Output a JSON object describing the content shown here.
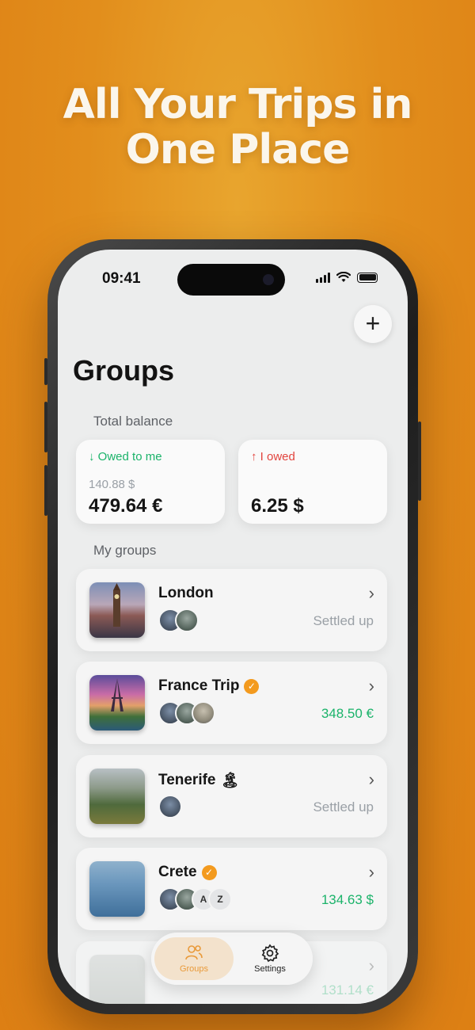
{
  "headline": {
    "line1": "All Your Trips in",
    "line2": "One Place"
  },
  "status_bar": {
    "time": "09:41"
  },
  "header": {
    "add_label": "+",
    "title": "Groups"
  },
  "balance": {
    "section_label": "Total balance",
    "owed_to_me": {
      "arrow": "↓",
      "label": "Owed to me",
      "secondary": "140.88 $",
      "primary": "479.64 €"
    },
    "i_owed": {
      "arrow": "↑",
      "label": "I owed",
      "primary": "6.25 $"
    }
  },
  "groups_section_label": "My groups",
  "groups": [
    {
      "name": "London",
      "badge": "",
      "emoji": "",
      "avatars": [
        "person",
        "person"
      ],
      "status": "Settled up",
      "status_type": "settled",
      "chevron": "›"
    },
    {
      "name": "France Trip",
      "badge": "✓",
      "emoji": "",
      "avatars": [
        "person",
        "person",
        "person"
      ],
      "status": "348.50 €",
      "status_type": "positive",
      "chevron": "›"
    },
    {
      "name": "Tenerife",
      "badge": "",
      "emoji": "🏝",
      "avatars": [
        "person"
      ],
      "status": "Settled up",
      "status_type": "settled",
      "chevron": "›"
    },
    {
      "name": "Crete",
      "badge": "✓",
      "emoji": "",
      "avatars": [
        "person",
        "person",
        "A",
        "Z"
      ],
      "status": "134.63 $",
      "status_type": "positive",
      "chevron": "›"
    },
    {
      "name": "",
      "badge": "",
      "emoji": "",
      "avatars": [],
      "status": "131.14 €",
      "status_type": "positive",
      "chevron": "›"
    }
  ],
  "tabbar": {
    "groups_label": "Groups",
    "settings_label": "Settings"
  },
  "colors": {
    "background": "#e28e1c",
    "accent": "#f39a1e",
    "positive": "#1bb36a",
    "negative": "#e2443e"
  }
}
